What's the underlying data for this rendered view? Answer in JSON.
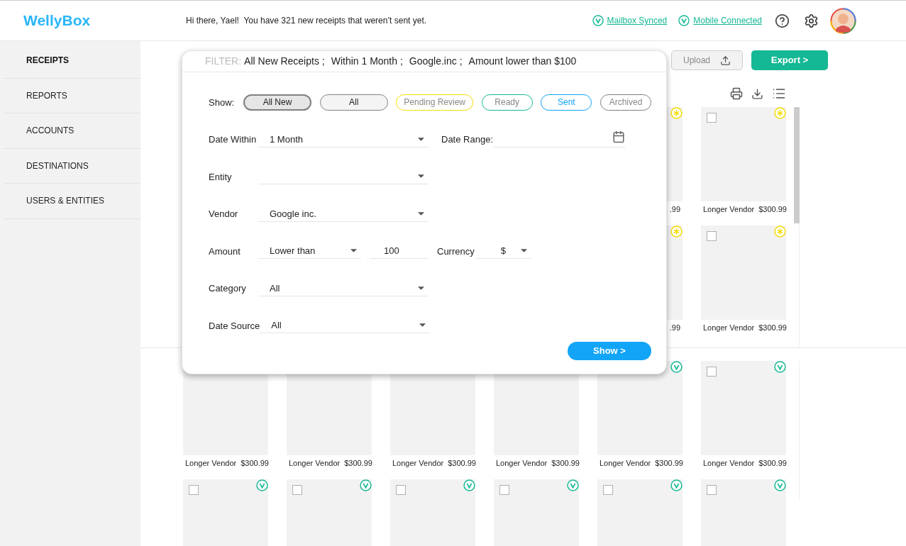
{
  "header": {
    "logo": "WellyBox",
    "greeting": "Hi there, Yael!  You have 321 new receipts that weren’t sent yet.",
    "status_links": [
      {
        "label": "Mailbox Synced"
      },
      {
        "label": "Mobile Connected"
      }
    ]
  },
  "sidebar": {
    "items": [
      {
        "label": "RECEIPTS",
        "selected": true
      },
      {
        "label": "REPORTS",
        "selected": false
      },
      {
        "label": "ACCOUNTS",
        "selected": false
      },
      {
        "label": "DESTINATIONS",
        "selected": false
      },
      {
        "label": "USERS & ENTITIES",
        "selected": false
      }
    ]
  },
  "toolbar": {
    "upload": "Upload",
    "export": "Export >"
  },
  "filter_panel": {
    "filter_label": "FILTER:",
    "filters": [
      "All New Receipts ;",
      "Within 1 Month ;",
      "Google.inc ;",
      "Amount lower than $100"
    ],
    "show_label": "Show:",
    "show_options": [
      {
        "label": "All New",
        "kind": "base",
        "color": "#808080",
        "selected": true
      },
      {
        "label": "All",
        "kind": "base",
        "color": "#808080",
        "selected": false
      },
      {
        "label": "Pending Review",
        "kind": "status",
        "color": "#f5dc00",
        "selected": false
      },
      {
        "label": "Ready",
        "kind": "status",
        "color": "#14b894",
        "selected": false
      },
      {
        "label": "Sent",
        "kind": "status",
        "color": "#0ea5f5",
        "selected": false
      },
      {
        "label": "Archived",
        "kind": "status",
        "color": "#808080",
        "selected": false
      }
    ],
    "rows": [
      {
        "items": [
          {
            "kind": "select",
            "label": "Date Within",
            "value": "1 Month"
          },
          {
            "kind": "date",
            "label": "Date Range:"
          }
        ]
      },
      {
        "items": [
          {
            "kind": "select",
            "label": "Entity"
          }
        ]
      },
      {
        "items": [
          {
            "kind": "select",
            "label": "Vendor",
            "value": "Google inc."
          }
        ]
      },
      {
        "items": [
          {
            "kind": "select",
            "label": "Amount",
            "value": "Lower than"
          },
          {
            "kind": "input",
            "value": "100"
          },
          {
            "kind": "select",
            "label": "Currency",
            "value": "$"
          }
        ]
      },
      {
        "items": [
          {
            "kind": "select",
            "label": "Category",
            "value": "All"
          }
        ]
      },
      {
        "items": [
          {
            "kind": "select",
            "label": "Date Source",
            "value": "All"
          }
        ]
      }
    ],
    "show_button": "Show >"
  },
  "receipts_top": [
    {
      "cards": [
        {
          "kind": "partial",
          "label": ".99",
          "starred": true
        },
        {
          "kind": "full",
          "vendor": "Longer Vendor",
          "amount": "$300.99",
          "starred": true,
          "checked": false
        }
      ]
    },
    {
      "cards": [
        {
          "kind": "partial",
          "label": ".99",
          "starred": true
        },
        {
          "kind": "full",
          "vendor": "Longer Vendor",
          "amount": "$300.99",
          "starred": true,
          "checked": false
        }
      ]
    }
  ],
  "receipts_bottom": [
    {
      "cards": [
        {
          "kind": "full",
          "vendor": "Longer Vendor",
          "amount": "$300.99"
        },
        {
          "kind": "full",
          "vendor": "Longer Vendor",
          "amount": "$300.99"
        },
        {
          "kind": "full",
          "vendor": "Longer Vendor",
          "amount": "$300.99"
        },
        {
          "kind": "full",
          "vendor": "Longer Vendor",
          "amount": "$300.99"
        },
        {
          "kind": "full",
          "vendor": "Longer Vendor",
          "amount": "$300.99",
          "verified": true
        },
        {
          "kind": "full",
          "vendor": "Longer Vendor",
          "amount": "$300.99",
          "verified": true,
          "checked": false
        }
      ]
    },
    {
      "cards": [
        {
          "kind": "image",
          "verified": true,
          "checked": false
        },
        {
          "kind": "image",
          "verified": true,
          "checked": false
        },
        {
          "kind": "image",
          "verified": true,
          "checked": false
        },
        {
          "kind": "image",
          "verified": true,
          "checked": false
        },
        {
          "kind": "image",
          "verified": true,
          "checked": false
        },
        {
          "kind": "image",
          "verified": true,
          "checked": false
        }
      ]
    }
  ]
}
